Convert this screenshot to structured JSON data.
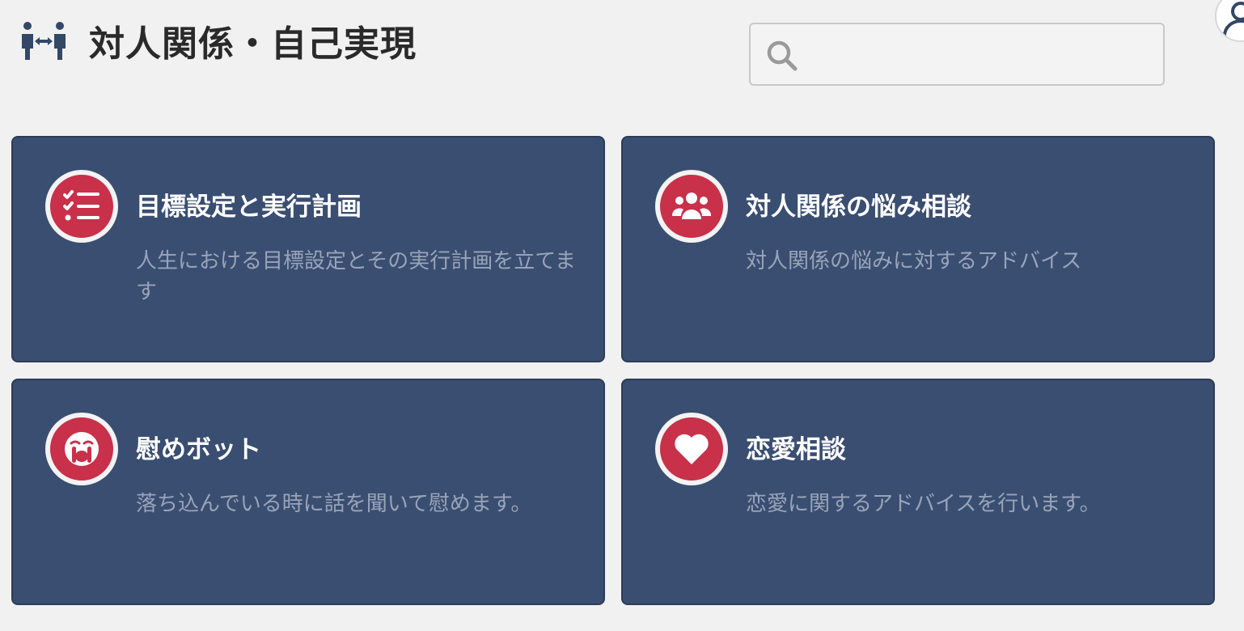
{
  "header": {
    "title": "対人関係・自己実現",
    "icon": "people-arrows-icon"
  },
  "search": {
    "placeholder": "",
    "value": "",
    "icon": "search-icon"
  },
  "cards": [
    {
      "title": "目標設定と実行計画",
      "description": "人生における目標設定とその実行計画を立てます",
      "icon": "checklist-icon"
    },
    {
      "title": "対人関係の悩み相談",
      "description": "対人関係の悩みに対するアドバイス",
      "icon": "users-icon"
    },
    {
      "title": "慰めボット",
      "description": "落ち込んでいる時に話を聞いて慰めます。",
      "icon": "crying-face-icon"
    },
    {
      "title": "恋愛相談",
      "description": "恋愛に関するアドバイスを行います。",
      "icon": "heart-icon"
    }
  ],
  "colors": {
    "background": "#f1f1f1",
    "card": "#3a4e72",
    "accent": "#c9304a",
    "card_title": "#ffffff",
    "card_description": "#98a4b8",
    "header_icon": "#334766"
  }
}
